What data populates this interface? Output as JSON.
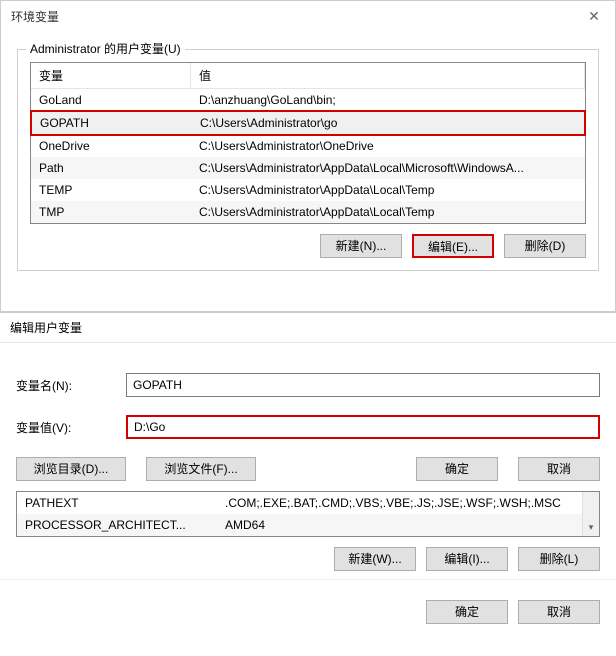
{
  "main": {
    "title": "环境变量",
    "group_label": "Administrator 的用户变量(U)",
    "columns": {
      "name": "变量",
      "value": "值"
    },
    "rows": [
      {
        "name": "GoLand",
        "value": "D:\\anzhuang\\GoLand\\bin;"
      },
      {
        "name": "GOPATH",
        "value": "C:\\Users\\Administrator\\go",
        "selected": true
      },
      {
        "name": "OneDrive",
        "value": "C:\\Users\\Administrator\\OneDrive"
      },
      {
        "name": "Path",
        "value": "C:\\Users\\Administrator\\AppData\\Local\\Microsoft\\WindowsA..."
      },
      {
        "name": "TEMP",
        "value": "C:\\Users\\Administrator\\AppData\\Local\\Temp"
      },
      {
        "name": "TMP",
        "value": "C:\\Users\\Administrator\\AppData\\Local\\Temp"
      }
    ],
    "buttons": {
      "new": "新建(N)...",
      "edit": "编辑(E)...",
      "del": "删除(D)"
    }
  },
  "edit": {
    "title": "编辑用户变量",
    "name_label": "变量名(N):",
    "name_value": "GOPATH",
    "value_label": "变量值(V):",
    "value_value": "D:\\Go",
    "browse_dir": "浏览目录(D)...",
    "browse_file": "浏览文件(F)...",
    "ok": "确定",
    "cancel": "取消"
  },
  "sys": {
    "rows": [
      {
        "name": "PATHEXT",
        "value": ".COM;.EXE;.BAT;.CMD;.VBS;.VBE;.JS;.JSE;.WSF;.WSH;.MSC"
      },
      {
        "name": "PROCESSOR_ARCHITECT...",
        "value": "AMD64"
      }
    ],
    "buttons": {
      "new": "新建(W)...",
      "edit": "编辑(I)...",
      "del": "删除(L)"
    }
  },
  "footer": {
    "ok": "确定",
    "cancel": "取消"
  }
}
